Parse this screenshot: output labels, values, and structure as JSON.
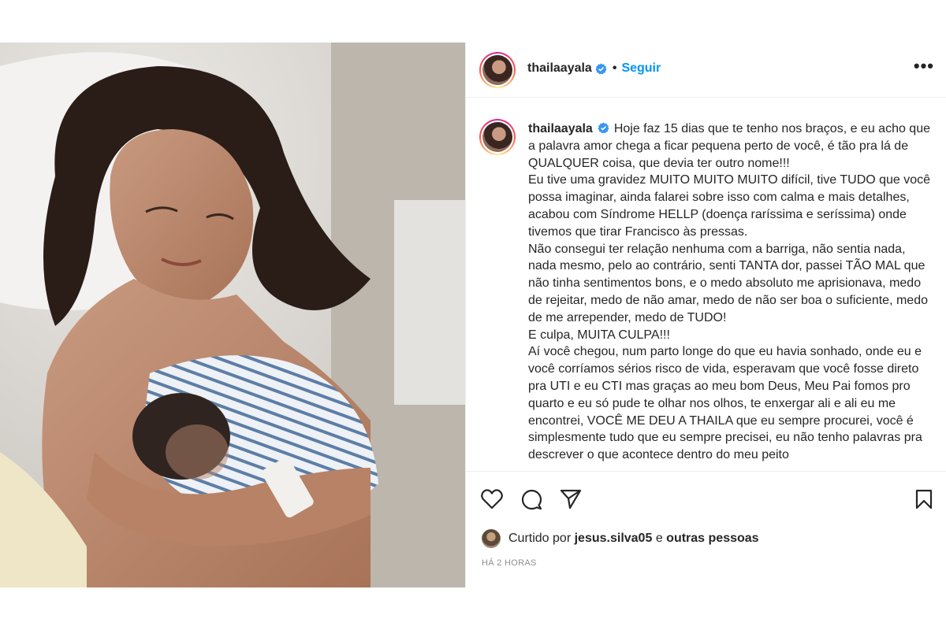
{
  "post": {
    "username": "thailaayala",
    "follow_label": "Seguir",
    "dot": "•",
    "more_label": "•••",
    "caption": "Hoje faz 15 dias que te tenho nos braços, e eu acho que a palavra amor chega a ficar pequena perto de você, é tão pra lá de QUALQUER coisa, que devia ter outro nome!!!\nEu tive uma gravidez MUITO MUITO MUITO difícil, tive TUDO que você possa imaginar, ainda falarei sobre isso com calma e mais detalhes, acabou com Síndrome HELLP (doença raríssima e seríssima) onde tivemos que tirar Francisco às pressas.\nNão consegui ter relação nenhuma com a barriga, não sentia nada, nada mesmo, pelo ao contrário, senti TANTA dor, passei TÃO MAL que não tinha sentimentos bons, e o medo absoluto me aprisionava, medo de rejeitar, medo de não amar, medo de não ser boa o suficiente, medo de me arrepender, medo de TUDO!\nE culpa, MUITA CULPA!!!\nAí você chegou, num parto longe do que eu havia sonhado, onde eu e você corríamos sérios risco de vida, esperavam que você fosse direto pra UTI e eu CTI mas graças ao meu bom Deus, Meu Pai fomos pro quarto e eu só pude te olhar nos olhos, te enxergar ali e ali eu me encontrei, VOCÊ ME DEU A THAILA que eu sempre procurei, você é simplesmente tudo que eu sempre precisei, eu não tenho palavras pra descrever o que acontece dentro do meu peito",
    "likes_prefix": "Curtido por",
    "liked_by_user": "jesus.silva05",
    "likes_conjunction": "e",
    "likes_others": "outras pessoas",
    "timestamp": "HÁ 2 HORAS"
  },
  "icons": {
    "verified": "verified-badge-icon",
    "like": "heart-icon",
    "comment": "comment-icon",
    "share": "paper-plane-icon",
    "save": "bookmark-icon"
  },
  "colors": {
    "accent": "#0095f6",
    "verified": "#3897f0",
    "muted": "#8e8e8e",
    "text": "#262626"
  }
}
